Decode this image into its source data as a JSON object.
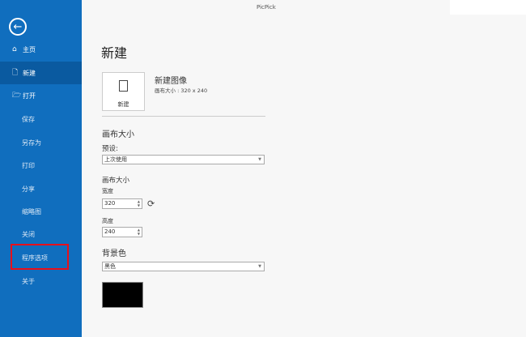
{
  "app_title": "PicPick",
  "sidebar": {
    "items": [
      {
        "label": "主页",
        "icon": "home-icon"
      },
      {
        "label": "新建",
        "icon": "document-icon"
      },
      {
        "label": "打开",
        "icon": "folder-open-icon"
      },
      {
        "label": "保存"
      },
      {
        "label": "另存为"
      },
      {
        "label": "打印"
      },
      {
        "label": "分享"
      },
      {
        "label": "缩略图"
      },
      {
        "label": "关闭"
      },
      {
        "label": "程序选项"
      },
      {
        "label": "关于"
      }
    ]
  },
  "main": {
    "title": "新建",
    "tile_label": "新建",
    "new_image_title": "新建图像",
    "new_image_sub": "画布大小 : 320 x 240",
    "canvas_section": "画布大小",
    "preset_label": "预设:",
    "preset_value": "上次使用",
    "canvas_size_label": "画布大小",
    "width_label": "宽度",
    "width_value": "320",
    "height_label": "高度",
    "height_value": "240",
    "bg_label": "背景色",
    "bg_value": "黑色",
    "bg_color": "#000000"
  }
}
